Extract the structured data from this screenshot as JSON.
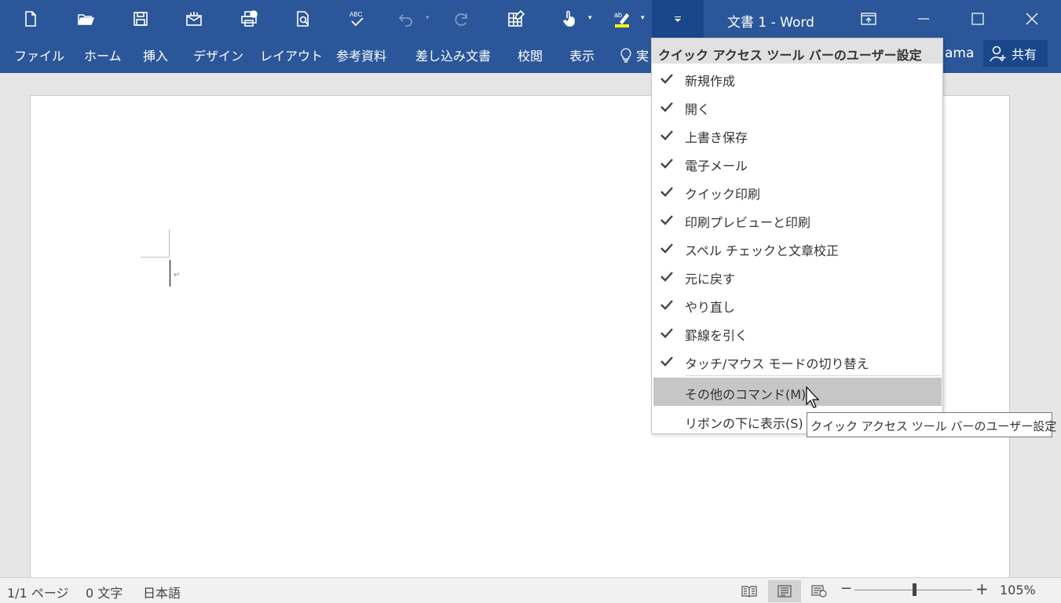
{
  "window": {
    "title": "文書 1 - Word"
  },
  "qat": {
    "icons": [
      "new-document-icon",
      "open-folder-icon",
      "save-icon",
      "email-icon",
      "quick-print-icon",
      "print-preview-icon",
      "spell-check-icon",
      "undo-icon",
      "redo-icon",
      "draw-table-icon",
      "touch-mode-icon",
      "highlight-icon",
      "customize-qat-icon"
    ]
  },
  "ribbon": {
    "tabs": [
      "ファイル",
      "ホーム",
      "挿入",
      "デザイン",
      "レイアウト",
      "参考資料",
      "差し込み文書",
      "校閲",
      "表示",
      "実"
    ],
    "user_fragment": "ama",
    "share_label": "共有"
  },
  "menu": {
    "header": "クイック アクセス ツール バーのユーザー設定",
    "items": [
      {
        "label": "新規作成",
        "checked": true
      },
      {
        "label": "開く",
        "checked": true
      },
      {
        "label": "上書き保存",
        "checked": true
      },
      {
        "label": "電子メール",
        "checked": true
      },
      {
        "label": "クイック印刷",
        "checked": true
      },
      {
        "label": "印刷プレビューと印刷",
        "checked": true
      },
      {
        "label": "スペル チェックと文章校正",
        "checked": true
      },
      {
        "label": "元に戻す",
        "checked": true
      },
      {
        "label": "やり直し",
        "checked": true
      },
      {
        "label": "罫線を引く",
        "checked": true
      },
      {
        "label": "タッチ/マウス モードの切り替え",
        "checked": true
      }
    ],
    "more_commands": "その他のコマンド(M)...",
    "show_below": "リボンの下に表示(S)"
  },
  "tooltip": {
    "text": "クイック アクセス ツール バーのユーザー設定"
  },
  "status": {
    "page": "1/1 ページ",
    "words": "0 文字",
    "language": "日本語",
    "zoom": "105%",
    "zoom_minus": "−",
    "zoom_plus": "+"
  },
  "document": {
    "para_mark": "↵"
  },
  "colors": {
    "ribbon": "#2b579a",
    "ribbon_dark": "#19478a",
    "menu_highlight": "#c6c6c6"
  }
}
